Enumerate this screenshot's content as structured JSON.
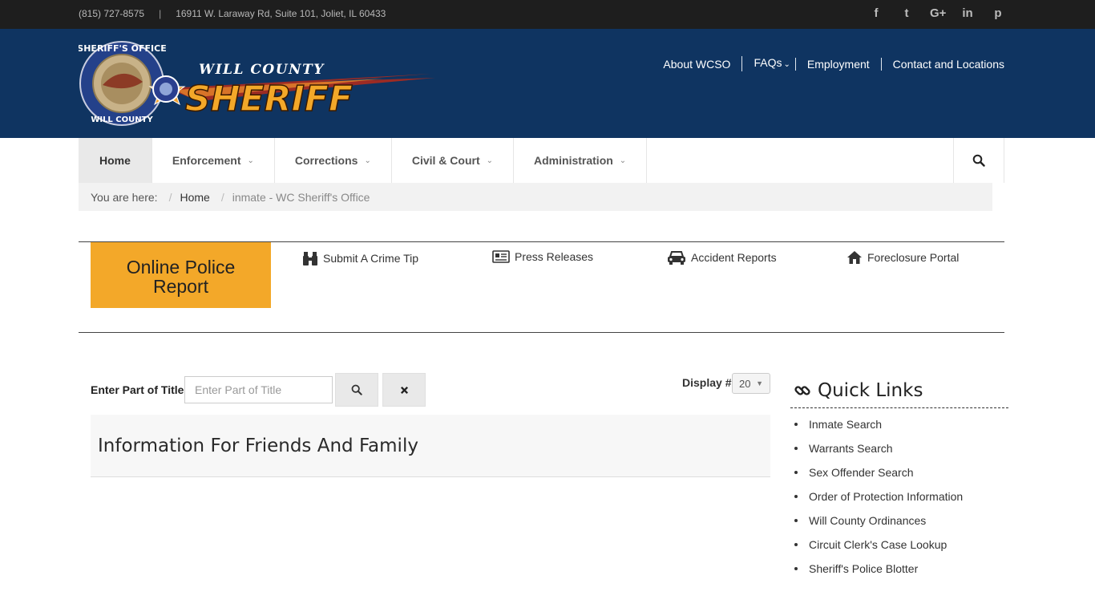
{
  "topbar": {
    "phone": "(815) 727-8575",
    "separator": "|",
    "address": "16911 W. Laraway Rd, Suite 101, Joliet, IL 60433",
    "social": [
      "f",
      "t",
      "G+",
      "in",
      "p"
    ]
  },
  "header": {
    "logo": {
      "top_text": "WILL COUNTY",
      "main_text": "SHERIFF",
      "seal_text": "SHERIFF'S OFFICE WILL COUNTY"
    },
    "nav": [
      "About WCSO",
      "FAQs",
      "Employment",
      "Contact and Locations"
    ]
  },
  "mainnav": {
    "items": [
      "Home",
      "Enforcement",
      "Corrections",
      "Civil & Court",
      "Administration"
    ],
    "search_icon": "search-icon"
  },
  "breadcrumb": {
    "label": "You are here:",
    "divider": "/",
    "home": "Home",
    "current": "inmate - WC Sheriff's Office"
  },
  "quickbar": {
    "online_report": "Online Police Report",
    "links": [
      {
        "label": "Submit A Crime Tip",
        "icon": "binoculars-icon"
      },
      {
        "label": "Press Releases",
        "icon": "newspaper-icon"
      },
      {
        "label": "Accident Reports",
        "icon": "car-icon"
      },
      {
        "label": "Foreclosure Portal",
        "icon": "home-icon"
      }
    ]
  },
  "filter": {
    "label": "Enter Part of Title",
    "placeholder": "Enter Part of Title",
    "display_label": "Display #",
    "display_value": "20"
  },
  "results": [
    {
      "title": "Information For Friends And Family"
    }
  ],
  "sidebar": {
    "title": "Quick Links",
    "links": [
      "Inmate Search",
      "Warrants Search",
      "Sex Offender Search",
      "Order of Protection Information",
      "Will County Ordinances",
      "Circuit Clerk's Case Lookup",
      "Sheriff's Police Blotter"
    ]
  },
  "colors": {
    "topbar": "#1e1e1e",
    "header": "#0f3461",
    "accent_orange": "#f3a829"
  }
}
